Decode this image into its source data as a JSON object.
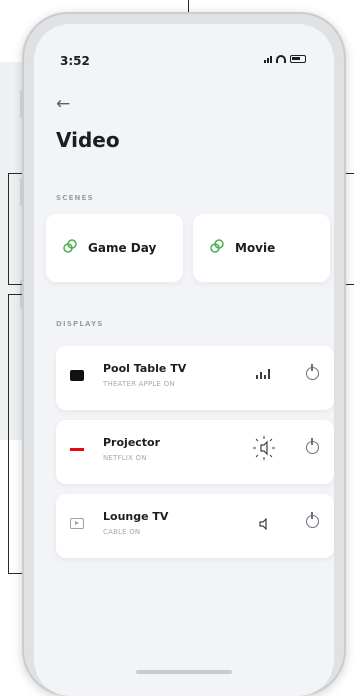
{
  "status_bar": {
    "time": "3:52"
  },
  "page": {
    "back_icon": "arrow-left-icon",
    "title": "Video"
  },
  "scenes": {
    "header": "SCENES",
    "items": [
      {
        "label": "Game Day",
        "icon": "scene-link-icon",
        "icon_color": "#4caf50"
      },
      {
        "label": "Movie",
        "icon": "scene-link-icon",
        "icon_color": "#4caf50"
      }
    ]
  },
  "displays": {
    "header": "DISPLAYS",
    "items": [
      {
        "name": "Pool Table TV",
        "status": "THEATER APPLE ON",
        "icon": "apple-tv-icon",
        "volume_icon": "volume-level-icon"
      },
      {
        "name": "Projector",
        "status": "NETFLIX ON",
        "icon": "netflix-icon",
        "volume_icon": "speaker-active-icon"
      },
      {
        "name": "Lounge TV",
        "status": "CABLE ON",
        "icon": "cable-tv-icon",
        "volume_icon": "speaker-icon"
      }
    ]
  },
  "colors": {
    "accent": "#4caf50",
    "netflix": "#e50914",
    "screen_bg": "#f3f4f7"
  }
}
